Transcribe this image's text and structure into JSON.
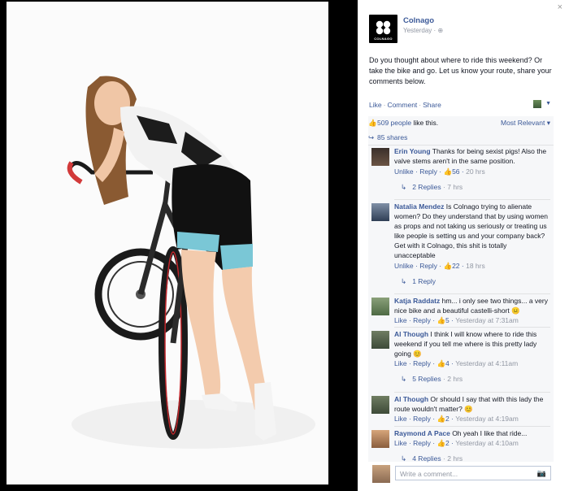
{
  "window": {
    "close_label": "×"
  },
  "post": {
    "page_name": "Colnago",
    "logo_text": "COLNAGO",
    "time": "Yesterday",
    "time_sep": "·",
    "audience_icon": "globe-icon",
    "text": "Do you thought about where to ride this weekend? Or take the bike and go. Let us know your route, share your comments below.",
    "actions": {
      "like": "Like",
      "comment": "Comment",
      "share": "Share",
      "sep": "·"
    }
  },
  "ufi": {
    "likes": "509 people",
    "likes_suffix": " like this.",
    "most_relevant": "Most Relevant",
    "shares": "85 shares"
  },
  "comments": [
    {
      "author": "Erin Young",
      "text": "Thanks for being sexist pigs! Also the valve stems aren't in the same position.",
      "unlike": "Unlike",
      "reply": "Reply",
      "likes": "56",
      "time": "20 hrs",
      "replies": "2 Replies",
      "replies_time": "7 hrs"
    },
    {
      "author": "Natalia Mendez",
      "text": "Is Colnago trying to alienate women? Do they understand that by using women as props and not taking us seriously or treating us like people is setting us and your company back? Get with it Colnago, this shit is totally unacceptable",
      "unlike": "Unlike",
      "reply": "Reply",
      "likes": "22",
      "time": "18 hrs",
      "replies": "1 Reply",
      "replies_time": ""
    },
    {
      "author": "Katja Raddatz",
      "text": "hm... i only see two things... a very nice bike and a beautiful castelli-short",
      "like": "Like",
      "reply": "Reply",
      "likes": "5",
      "time": "Yesterday at 7:31am"
    },
    {
      "author": "Al Though",
      "text": "I think I will know where to ride this weekend if you tell me where is this pretty lady going",
      "like": "Like",
      "reply": "Reply",
      "likes": "4",
      "time": "Yesterday at 4:11am",
      "replies": "5 Replies",
      "replies_time": "2 hrs"
    },
    {
      "author": "Al Though",
      "text": "Or should I say that with this lady the route wouldn't matter?",
      "like": "Like",
      "reply": "Reply",
      "likes": "2",
      "time": "Yesterday at 4:19am"
    },
    {
      "author": "Raymond A Pace",
      "text": "Oh yeah I like that ride...",
      "like": "Like",
      "reply": "Reply",
      "likes": "2",
      "time": "Yesterday at 4:10am",
      "replies": "4 Replies",
      "replies_time": "2 hrs"
    }
  ],
  "composer": {
    "placeholder": "Write a comment..."
  },
  "colors": {
    "link": "#3b5998",
    "muted": "#9197a3",
    "ufi_bg": "#f6f7f9",
    "panel_bg": "#ffffff",
    "backdrop": "#000000"
  }
}
